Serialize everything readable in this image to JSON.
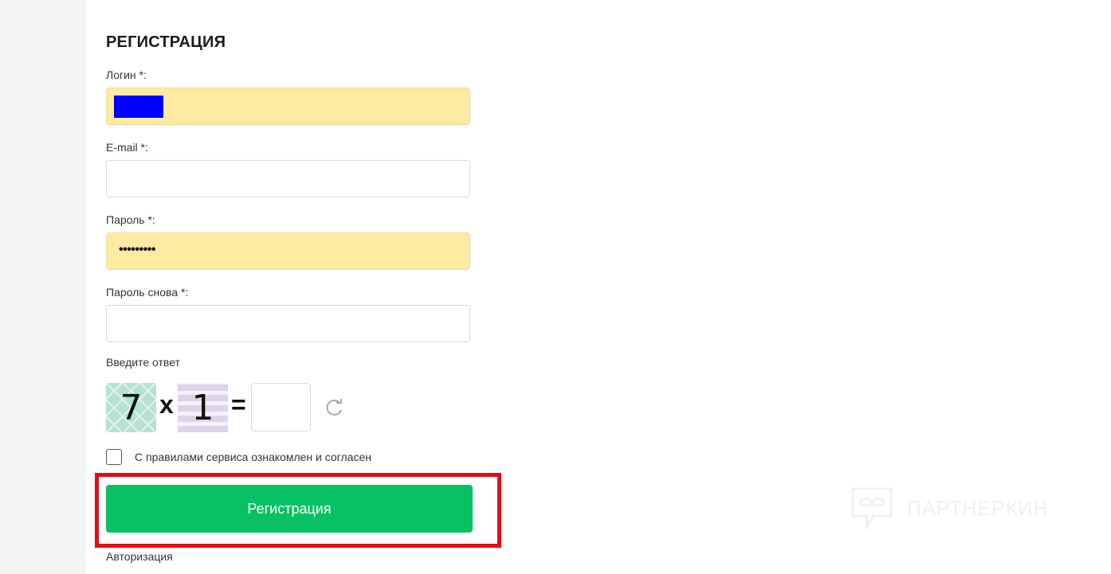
{
  "form": {
    "title": "РЕГИСТРАЦИЯ",
    "login_label": "Логин *:",
    "email_label": "E-mail *:",
    "password_label": "Пароль *:",
    "password_value_masked": "•••••••••",
    "password_repeat_label": "Пароль снова *:",
    "captcha_label": "Введите ответ",
    "captcha": {
      "left_operand": "7",
      "operator": "x",
      "right_operand": "1",
      "equals": "="
    },
    "agree_label": "С правилами сервиса ознакомлен и согласен",
    "agree_checked": false,
    "submit_label": "Регистрация",
    "auth_link": "Авторизация"
  },
  "watermark": {
    "text": "ПАРТНЕРКИН"
  },
  "colors": {
    "autofill_bg": "#feeaa3",
    "submit_bg": "#07c164",
    "highlight": "#e20e16",
    "redaction": "#0000ff"
  },
  "icons": [
    "refresh-icon",
    "watermark-logo-icon"
  ]
}
